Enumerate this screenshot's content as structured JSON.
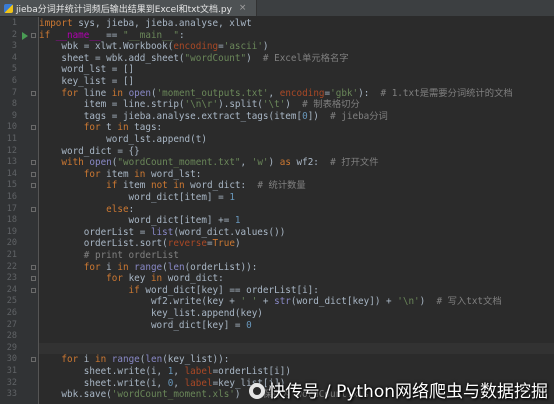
{
  "tab": {
    "icon": "python-file-icon",
    "title": "jieba分词并统计词频后输出结果到Excel和txt文档.py",
    "close": "×"
  },
  "code_lines": [
    {
      "n": "1",
      "t": [
        [
          "kw",
          "import "
        ],
        [
          "",
          "sys, jieba, jieba.analyse, xlwt"
        ]
      ]
    },
    {
      "n": "2",
      "t": [
        [
          "kw",
          "if "
        ],
        [
          "dn",
          "__name__"
        ],
        [
          "",
          " == "
        ],
        [
          "st",
          "\"__main__\""
        ],
        [
          "",
          ":"
        ]
      ]
    },
    {
      "n": "3",
      "t": [
        [
          "",
          "    wbk = xlwt.Workbook("
        ],
        [
          "pa",
          "encoding"
        ],
        [
          "",
          "="
        ],
        [
          "st",
          "'ascii'"
        ],
        [
          "",
          ")"
        ]
      ]
    },
    {
      "n": "4",
      "t": [
        [
          "",
          "    sheet = wbk.add_sheet("
        ],
        [
          "st",
          "\"wordCount\""
        ],
        [
          "",
          ")  "
        ],
        [
          "cm",
          "# Excel单元格名字"
        ]
      ]
    },
    {
      "n": "5",
      "t": [
        [
          "",
          "    word_lst = []"
        ]
      ]
    },
    {
      "n": "6",
      "t": [
        [
          "",
          "    key_list = []"
        ]
      ]
    },
    {
      "n": "7",
      "t": [
        [
          "kw",
          "    for "
        ],
        [
          "",
          "line "
        ],
        [
          "kw",
          "in "
        ],
        [
          "bi",
          "open"
        ],
        [
          "",
          "("
        ],
        [
          "st",
          "'moment_outputs.txt'"
        ],
        [
          "",
          ", "
        ],
        [
          "pa",
          "encoding"
        ],
        [
          "",
          "="
        ],
        [
          "st",
          "'gbk'"
        ],
        [
          "",
          "):  "
        ],
        [
          "cm",
          "# 1.txt是需要分词统计的文档"
        ]
      ]
    },
    {
      "n": "8",
      "t": [
        [
          "",
          "        item = line.strip("
        ],
        [
          "st",
          "'\\n\\r'"
        ],
        [
          "",
          ").split("
        ],
        [
          "st",
          "'\\t'"
        ],
        [
          "",
          ")  "
        ],
        [
          "cm",
          "# 制表格切分"
        ]
      ]
    },
    {
      "n": "9",
      "t": [
        [
          "",
          "        tags = jieba.analyse.extract_tags(item["
        ],
        [
          "nm",
          "0"
        ],
        [
          "",
          "])  "
        ],
        [
          "cm",
          "# jieba分词"
        ]
      ]
    },
    {
      "n": "10",
      "t": [
        [
          "kw",
          "        for "
        ],
        [
          "",
          "t "
        ],
        [
          "kw",
          "in "
        ],
        [
          "",
          "tags:"
        ]
      ]
    },
    {
      "n": "11",
      "t": [
        [
          "",
          "            word_lst.append(t)"
        ]
      ]
    },
    {
      "n": "12",
      "t": [
        [
          "",
          "    word_dict = {}"
        ]
      ]
    },
    {
      "n": "13",
      "t": [
        [
          "kw",
          "    with "
        ],
        [
          "bi",
          "open"
        ],
        [
          "",
          "("
        ],
        [
          "st",
          "\"wordCount_moment.txt\""
        ],
        [
          "",
          ", "
        ],
        [
          "st",
          "'w'"
        ],
        [
          "",
          ") "
        ],
        [
          "kw",
          "as "
        ],
        [
          "",
          "wf2:  "
        ],
        [
          "cm",
          "# 打开文件"
        ]
      ]
    },
    {
      "n": "14",
      "t": [
        [
          "kw",
          "        for "
        ],
        [
          "",
          "item "
        ],
        [
          "kw",
          "in "
        ],
        [
          "",
          "word_lst:"
        ]
      ]
    },
    {
      "n": "15",
      "t": [
        [
          "kw",
          "            if "
        ],
        [
          "",
          "item "
        ],
        [
          "kw",
          "not in "
        ],
        [
          "",
          "word_dict:  "
        ],
        [
          "cm",
          "# 统计数量"
        ]
      ]
    },
    {
      "n": "16",
      "t": [
        [
          "",
          "                word_dict[item] = "
        ],
        [
          "nm",
          "1"
        ]
      ]
    },
    {
      "n": "17",
      "t": [
        [
          "kw",
          "            else"
        ],
        [
          "",
          ":"
        ]
      ]
    },
    {
      "n": "18",
      "t": [
        [
          "",
          "                word_dict[item] += "
        ],
        [
          "nm",
          "1"
        ]
      ]
    },
    {
      "n": "19",
      "t": [
        [
          "",
          "        orderList = "
        ],
        [
          "bi",
          "list"
        ],
        [
          "",
          "(word_dict.values())"
        ]
      ]
    },
    {
      "n": "20",
      "t": [
        [
          "",
          "        orderList.sort("
        ],
        [
          "pa",
          "reverse"
        ],
        [
          "",
          "="
        ],
        [
          "kw",
          "True"
        ],
        [
          "",
          ")"
        ]
      ]
    },
    {
      "n": "21",
      "t": [
        [
          "cm",
          "        # print orderList"
        ]
      ]
    },
    {
      "n": "22",
      "t": [
        [
          "kw",
          "        for "
        ],
        [
          "",
          "i "
        ],
        [
          "kw",
          "in "
        ],
        [
          "bi",
          "range"
        ],
        [
          "",
          "("
        ],
        [
          "bi",
          "len"
        ],
        [
          "",
          "(orderList)):"
        ]
      ]
    },
    {
      "n": "23",
      "t": [
        [
          "kw",
          "            for "
        ],
        [
          "",
          "key "
        ],
        [
          "kw",
          "in "
        ],
        [
          "",
          "word_dict:"
        ]
      ]
    },
    {
      "n": "24",
      "t": [
        [
          "kw",
          "                if "
        ],
        [
          "",
          "word_dict[key] == orderList[i]:"
        ]
      ]
    },
    {
      "n": "25",
      "t": [
        [
          "",
          "                    wf2.write(key + "
        ],
        [
          "st",
          "' '"
        ],
        [
          "",
          " + "
        ],
        [
          "bi",
          "str"
        ],
        [
          "",
          "(word_dict[key]) + "
        ],
        [
          "st",
          "'\\n'"
        ],
        [
          "",
          ")  "
        ],
        [
          "cm",
          "# 写入txt文档"
        ]
      ]
    },
    {
      "n": "26",
      "t": [
        [
          "",
          "                    key_list.append(key)"
        ]
      ]
    },
    {
      "n": "27",
      "t": [
        [
          "",
          "                    word_dict[key] = "
        ],
        [
          "nm",
          "0"
        ]
      ]
    },
    {
      "n": "28",
      "t": [
        [
          "",
          ""
        ]
      ]
    },
    {
      "n": "29",
      "t": [
        [
          "",
          ""
        ]
      ]
    },
    {
      "n": "30",
      "t": [
        [
          "kw",
          "    for "
        ],
        [
          "",
          "i "
        ],
        [
          "kw",
          "in "
        ],
        [
          "bi",
          "range"
        ],
        [
          "",
          "("
        ],
        [
          "bi",
          "len"
        ],
        [
          "",
          "(key_list)):"
        ]
      ]
    },
    {
      "n": "31",
      "t": [
        [
          "",
          "        sheet.write(i, "
        ],
        [
          "nm",
          "1"
        ],
        [
          "",
          ", "
        ],
        [
          "pa",
          "label"
        ],
        [
          "",
          "=orderList[i])"
        ]
      ]
    },
    {
      "n": "32",
      "t": [
        [
          "",
          "        sheet.write(i, "
        ],
        [
          "nm",
          "0"
        ],
        [
          "",
          ", "
        ],
        [
          "pa",
          "label"
        ],
        [
          "",
          "=key_list[i])"
        ]
      ]
    },
    {
      "n": "33",
      "t": [
        [
          "",
          "    wbk.save("
        ],
        [
          "st",
          "'wordCount_moment.xls'"
        ],
        [
          "",
          ")  "
        ],
        [
          "cm",
          "# 保存为 wordCount.xls"
        ]
      ]
    }
  ],
  "watermark": {
    "icon": "wechat-icon",
    "text": "快传号 / Python网络爬虫与数据挖掘"
  },
  "colors": {
    "background": "#2b2b2b",
    "keyword": "#cc7832",
    "string": "#6a8759",
    "comment": "#808080"
  }
}
